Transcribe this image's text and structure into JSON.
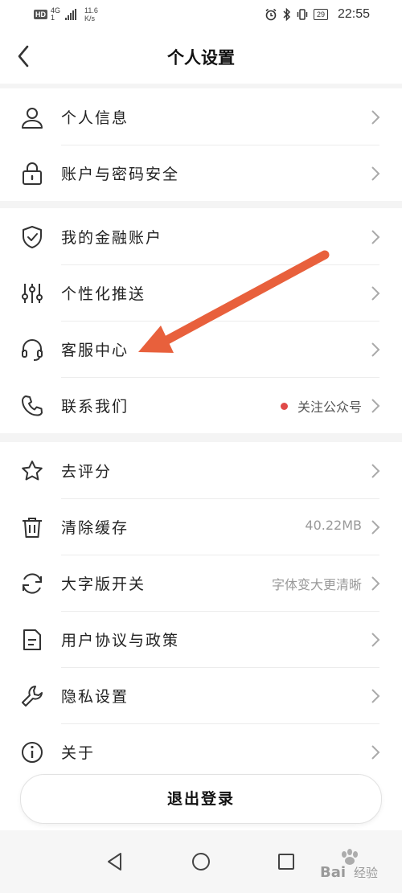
{
  "status_bar": {
    "hd": "HD",
    "network": "4G",
    "network_sub": "1",
    "speed_value": "11.6",
    "speed_unit": "K/s",
    "battery": "29",
    "time": "22:55"
  },
  "header": {
    "title": "个人设置"
  },
  "groups": [
    {
      "items": [
        {
          "label": "个人信息",
          "icon": "person-icon"
        },
        {
          "label": "账户与密码安全",
          "icon": "lock-icon"
        }
      ]
    },
    {
      "items": [
        {
          "label": "我的金融账户",
          "icon": "shield-icon"
        },
        {
          "label": "个性化推送",
          "icon": "sliders-icon"
        },
        {
          "label": "客服中心",
          "icon": "headset-icon"
        },
        {
          "label": "联系我们",
          "icon": "phone-icon",
          "value": "关注公众号",
          "dot_color": "#e04a48"
        }
      ]
    },
    {
      "items": [
        {
          "label": "去评分",
          "icon": "star-icon"
        },
        {
          "label": "清除缓存",
          "icon": "trash-icon",
          "value": "40.22MB"
        },
        {
          "label": "大字版开关",
          "icon": "refresh-icon",
          "value": "字体变大更清晰"
        },
        {
          "label": "用户协议与政策",
          "icon": "document-icon"
        },
        {
          "label": "隐私设置",
          "icon": "wrench-icon"
        },
        {
          "label": "关于",
          "icon": "info-icon"
        }
      ]
    }
  ],
  "logout": {
    "label": "退出登录"
  },
  "annotation_arrow": {
    "color": "#e8603c"
  },
  "watermark": {
    "text_1": "Bai",
    "text_2": "经验"
  }
}
